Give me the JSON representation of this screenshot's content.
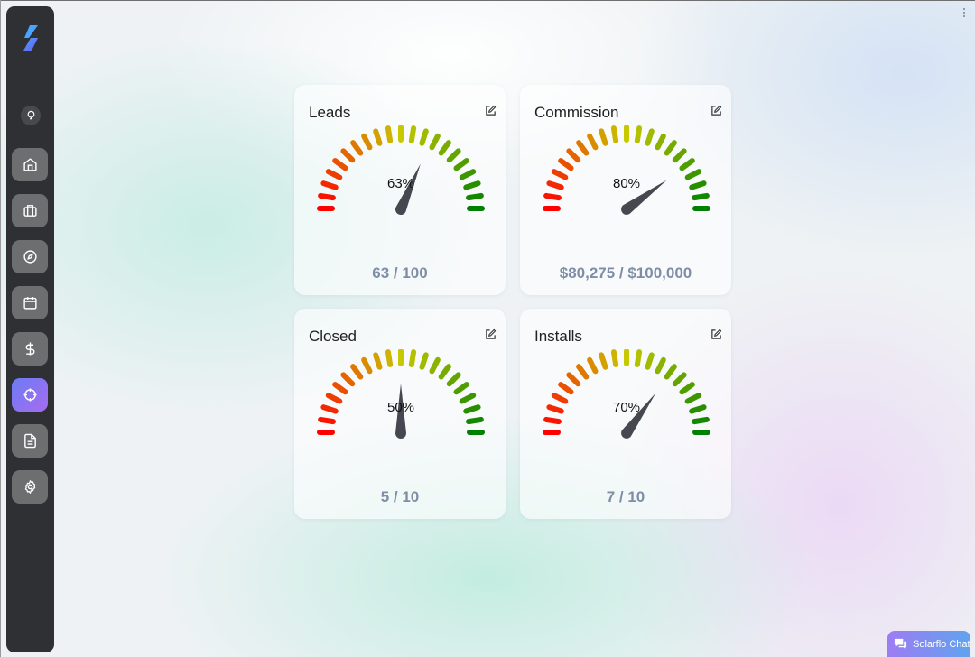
{
  "cards": [
    {
      "title": "Leads",
      "percent_label": "63%",
      "percent": 63,
      "value": "63 / 100"
    },
    {
      "title": "Commission",
      "percent_label": "80%",
      "percent": 80,
      "value": "$80,275 / $100,000"
    },
    {
      "title": "Closed",
      "percent_label": "50%",
      "percent": 50,
      "value": "5 / 10"
    },
    {
      "title": "Installs",
      "percent_label": "70%",
      "percent": 70,
      "value": "7 / 10"
    }
  ],
  "chat": {
    "label": "Solarflo Chat"
  },
  "sidebar": {
    "items": [
      {
        "icon": "home-icon"
      },
      {
        "icon": "briefcase-icon"
      },
      {
        "icon": "compass-icon"
      },
      {
        "icon": "calendar-icon"
      },
      {
        "icon": "dollar-icon"
      },
      {
        "icon": "target-icon",
        "active": true
      },
      {
        "icon": "document-icon"
      },
      {
        "icon": "gear-icon"
      }
    ]
  },
  "colors": {
    "sidebar_bg": "#2f3033",
    "nav_button": "#6d6e70",
    "active_gradient_start": "#6c7cf5",
    "active_gradient_end": "#a66cf0",
    "value_text": "#7f8ea6",
    "gauge_start": "#ff0000",
    "gauge_mid": "#c8c800",
    "gauge_end": "#008000",
    "needle": "#45484f"
  }
}
